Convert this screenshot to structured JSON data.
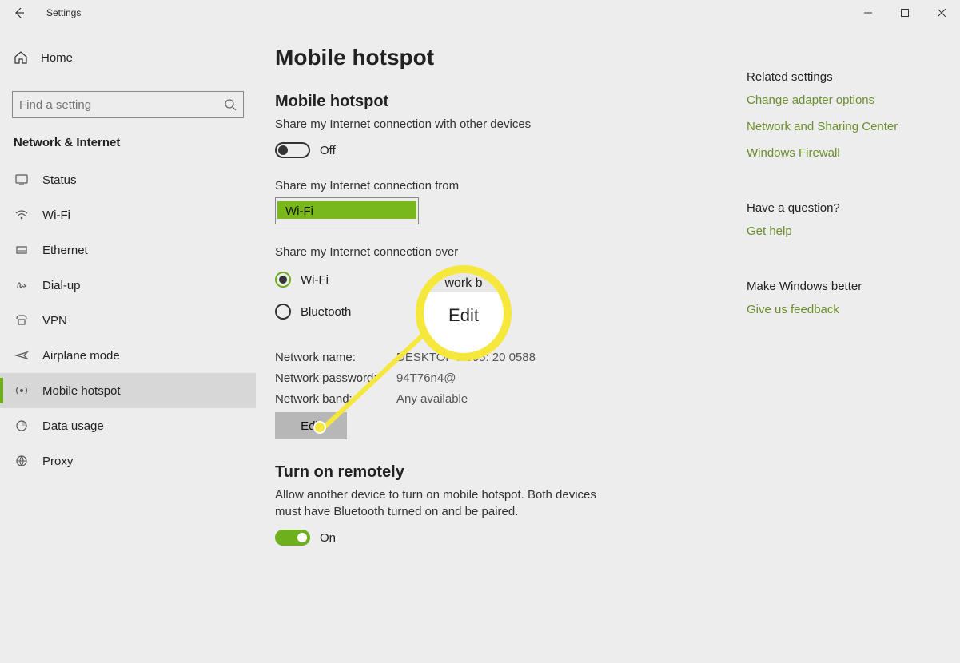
{
  "window": {
    "title": "Settings"
  },
  "sidebar": {
    "home_label": "Home",
    "search_placeholder": "Find a setting",
    "category": "Network & Internet",
    "items": [
      {
        "label": "Status"
      },
      {
        "label": "Wi-Fi"
      },
      {
        "label": "Ethernet"
      },
      {
        "label": "Dial-up"
      },
      {
        "label": "VPN"
      },
      {
        "label": "Airplane mode"
      },
      {
        "label": "Mobile hotspot"
      },
      {
        "label": "Data usage"
      },
      {
        "label": "Proxy"
      }
    ]
  },
  "page": {
    "title": "Mobile hotspot",
    "section1_title": "Mobile hotspot",
    "section1_sub": "Share my Internet connection with other devices",
    "toggle1_label": "Off",
    "share_from_label": "Share my Internet connection from",
    "share_from_value": "Wi-Fi",
    "share_over_label": "Share my Internet connection over",
    "radio_wifi": "Wi-Fi",
    "radio_bt": "Bluetooth",
    "net_name_key": "Network name:",
    "net_name_val": "DESKTOP-A005: 20 0588",
    "net_pass_key": "Network password:",
    "net_pass_val": "94T76n4@",
    "net_band_key": "Network band:",
    "net_band_val": "Any available",
    "edit_btn": "Edit",
    "section2_title": "Turn on remotely",
    "section2_sub": "Allow another device to turn on mobile hotspot. Both devices must have Bluetooth turned on and be paired.",
    "toggle2_label": "On"
  },
  "right": {
    "related_title": "Related settings",
    "link1": "Change adapter options",
    "link2": "Network and Sharing Center",
    "link3": "Windows Firewall",
    "question_title": "Have a question?",
    "link4": "Get help",
    "better_title": "Make Windows better",
    "link5": "Give us feedback"
  },
  "magnifier": {
    "top_text": "work b",
    "edit_text": "Edit"
  }
}
